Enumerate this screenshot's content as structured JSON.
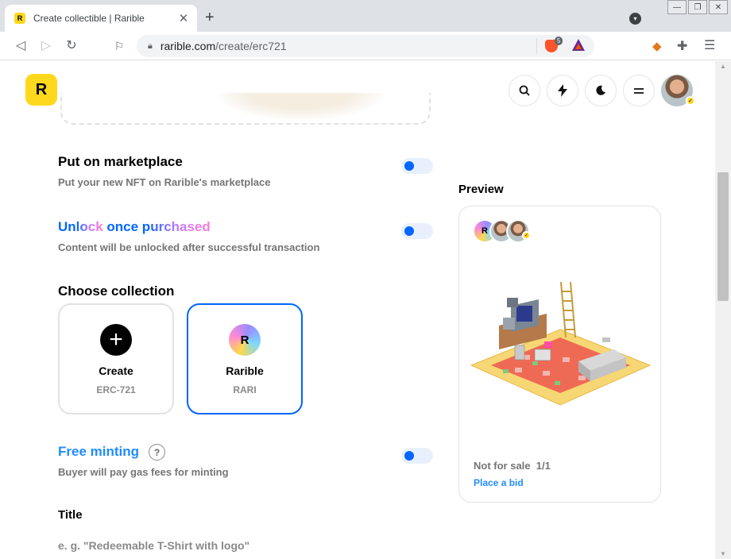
{
  "browser": {
    "tab_title": "Create collectible | Rarible",
    "favicon_label": "R",
    "url_host": "rarible.com",
    "url_path": "/create/erc721",
    "brave_badge": "5",
    "icons": {
      "back": "arrow-left-icon",
      "forward": "arrow-right-icon",
      "reload": "reload-icon",
      "bookmark": "bookmark-icon",
      "lock": "lock-icon",
      "menu": "kebab-menu-icon"
    }
  },
  "header": {
    "logo_label": "R",
    "buttons": [
      "search",
      "activity",
      "theme",
      "menu"
    ]
  },
  "sections": {
    "marketplace": {
      "title": "Put on marketplace",
      "subtitle": "Put your new NFT on Rarible's marketplace",
      "enabled": false
    },
    "unlock": {
      "title_part1": "Unlock",
      "title_part2": " once purchased",
      "subtitle": "Content will be unlocked after successful transaction",
      "enabled": false
    },
    "collection": {
      "title": "Choose collection",
      "options": [
        {
          "name": "Create",
          "sub": "ERC-721",
          "icon": "plus-icon",
          "selected": false
        },
        {
          "name": "Rarible",
          "sub": "RARI",
          "icon": "rarible-logo",
          "selected": true
        }
      ]
    },
    "free_minting": {
      "title": "Free minting",
      "help": "?",
      "subtitle": "Buyer will pay gas fees for minting",
      "enabled": false
    },
    "title_field": {
      "label": "Title",
      "placeholder": "e. g. \"Redeemable T-Shirt with logo\"",
      "value": ""
    }
  },
  "preview": {
    "label": "Preview",
    "sale_status": "Not for sale",
    "edition": "1/1",
    "action": "Place a bid"
  },
  "colors": {
    "brand_yellow": "#fed81c",
    "accent_blue": "#0066ff",
    "link_blue": "#1f8cff",
    "muted": "#757575"
  }
}
